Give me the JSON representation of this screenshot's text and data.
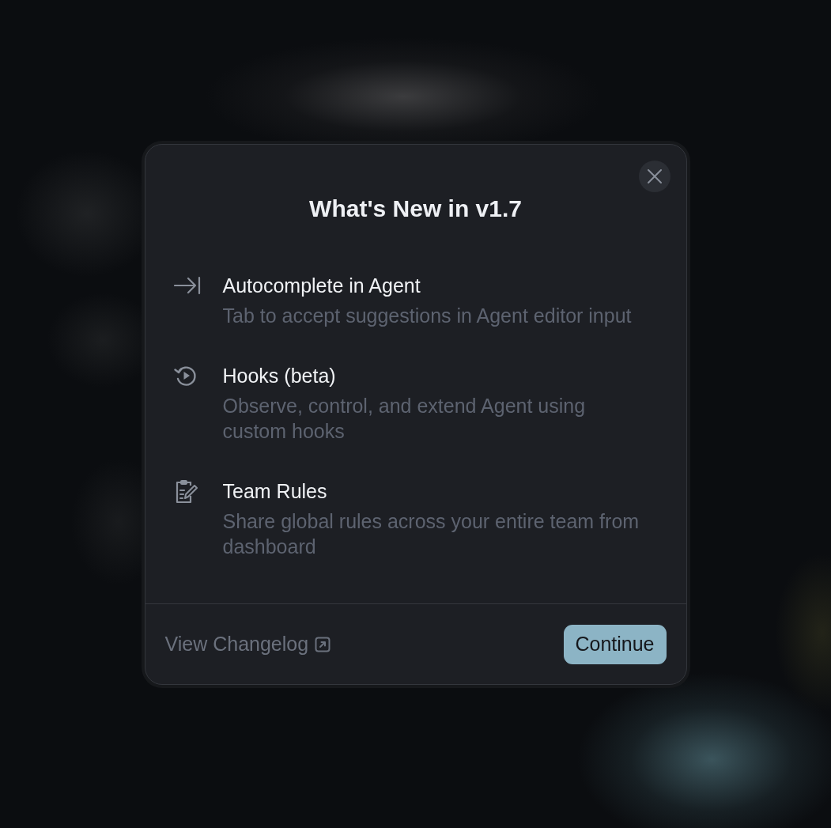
{
  "dialog": {
    "title": "What's New in v1.7",
    "features": [
      {
        "kind": "autocomplete",
        "title": "Autocomplete in Agent",
        "description": "Tab to accept suggestions in Agent editor input"
      },
      {
        "kind": "hooks",
        "title": "Hooks (beta)",
        "description": "Observe, control, and extend Agent using custom hooks"
      },
      {
        "kind": "rules",
        "title": "Team Rules",
        "description": "Share global rules across your entire team from dashboard"
      }
    ],
    "footer": {
      "link": "View Changelog",
      "button": "Continue"
    }
  }
}
